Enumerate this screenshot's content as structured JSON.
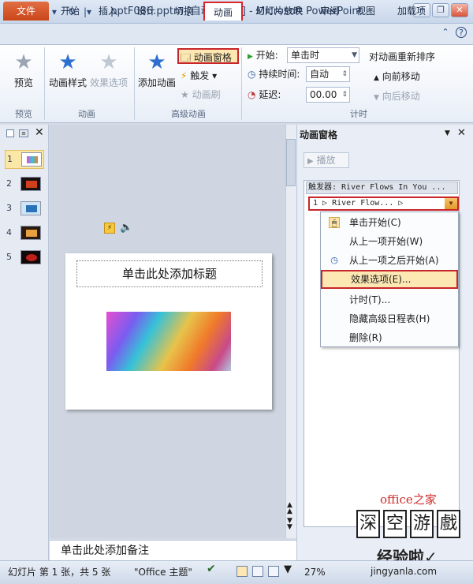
{
  "window": {
    "app_icon": "P",
    "title": "pptF086.pptm [自动保存的] - Microsoft PowerPoint",
    "minimize": "─",
    "restore": "❐",
    "close": "✕"
  },
  "qat": {
    "save_icon": "floppy-icon",
    "undo": "↶ ▾",
    "redo": "↻",
    "customize": "|▾"
  },
  "tabs": [
    "文件",
    "开始",
    "插入",
    "设计",
    "切换",
    "动画",
    "幻灯片放映",
    "审阅",
    "视图",
    "加载项"
  ],
  "ribbon_ctrl": {
    "collapse": "⌃",
    "help": "?"
  },
  "ribbon": {
    "preview": {
      "label": "预览",
      "group": "预览"
    },
    "animation_group": {
      "style_label": "动画样式",
      "effect_label": "效果选项",
      "group": "动画"
    },
    "advanced_group": {
      "add_label": "添加动画",
      "pane_label": "动画窗格",
      "trigger_label": "触发 ▾",
      "painter_label": "动画刷",
      "group": "高级动画"
    },
    "timing": {
      "start_label": "开始:",
      "start_value": "单击时",
      "duration_label": "持续时间:",
      "duration_value": "自动",
      "delay_label": "延迟:",
      "delay_value": "00.00",
      "reorder_title": "对动画重新排序",
      "move_earlier": "向前移动",
      "move_later": "向后移动",
      "group": "计时"
    }
  },
  "slides": [
    "1",
    "2",
    "3",
    "4",
    "5"
  ],
  "slide": {
    "title_placeholder": "单击此处添加标题"
  },
  "notes_placeholder": "单击此处添加备注",
  "anim_pane": {
    "title": "动画窗格",
    "play": "播放",
    "trigger_header": "触发器: River Flows In You ...",
    "item": "1 ▷ River Flow... ▷",
    "menu": [
      {
        "label": "单击开始(C)",
        "icon": "mouse-icon"
      },
      {
        "label": "从上一项开始(W)",
        "icon": ""
      },
      {
        "label": "从上一项之后开始(A)",
        "icon": "clock-icon"
      },
      {
        "label": "效果选项(E)...",
        "icon": ""
      },
      {
        "label": "计时(T)...",
        "icon": ""
      },
      {
        "label": "隐藏高级日程表(H)",
        "icon": ""
      },
      {
        "label": "删除(R)",
        "icon": ""
      }
    ]
  },
  "watermark": {
    "brand": "office之家",
    "chars": [
      "深",
      "空",
      "游",
      "戲"
    ],
    "cn": "经验啦✓",
    "url": "jingyanla.com"
  },
  "status": {
    "slide_info": "幻灯片 第 1 张，共 5 张",
    "theme": "\"Office 主题\"",
    "zoom": "27%"
  }
}
